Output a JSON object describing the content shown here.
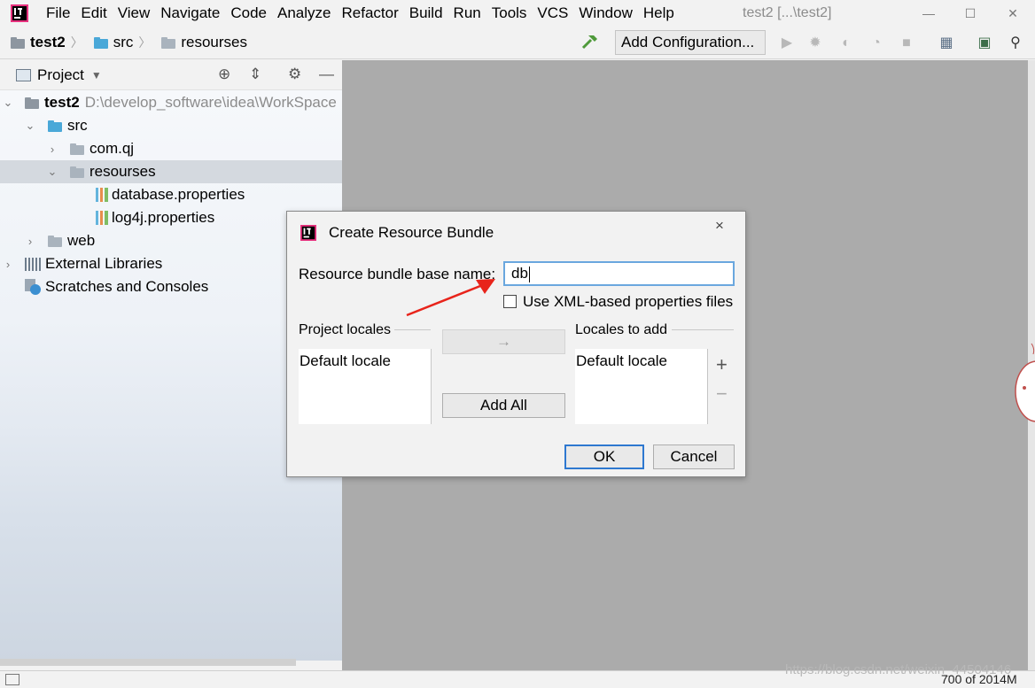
{
  "menubar": {
    "items": [
      "File",
      "Edit",
      "View",
      "Navigate",
      "Code",
      "Analyze",
      "Refactor",
      "Build",
      "Run",
      "Tools",
      "VCS",
      "Window",
      "Help"
    ],
    "window_title": "test2 [...\\test2]",
    "controls": {
      "minimize": "—",
      "maximize": "☐",
      "close": "✕"
    }
  },
  "navbar": {
    "breadcrumbs": [
      "test2",
      "src",
      "resourses"
    ],
    "add_configuration": "Add Configuration..."
  },
  "project_panel": {
    "title": "Project",
    "tree": [
      {
        "label": "test2",
        "path": "D:\\develop_software\\idea\\WorkSpace"
      },
      {
        "label": "src"
      },
      {
        "label": "com.qj"
      },
      {
        "label": "resourses"
      },
      {
        "label": "database.properties"
      },
      {
        "label": "log4j.properties"
      },
      {
        "label": "web"
      },
      {
        "label": "External Libraries"
      },
      {
        "label": "Scratches and Consoles"
      }
    ]
  },
  "dialog": {
    "title": "Create Resource Bundle",
    "close": "×",
    "base_name_label": "Resource bundle base name:",
    "base_name_value": "db",
    "use_xml_label": "Use XML-based properties files",
    "project_locales_label": "Project locales",
    "project_locales": [
      "Default locale"
    ],
    "locales_to_add_label": "Locales to add",
    "locales_to_add": [
      "Default locale"
    ],
    "move_arrow": "→",
    "add_all": "Add All",
    "ok": "OK",
    "cancel": "Cancel",
    "plus": "+",
    "minus": "−"
  },
  "statusbar": {
    "watermark": "https://blog.csdn.net/weixin_44504146",
    "memory": "700 of 2014M"
  },
  "colors": {
    "accent": "#2e78d0",
    "input_focus": "#6aa7de",
    "annotation": "#e8241b",
    "selection": "#d4d9df"
  }
}
